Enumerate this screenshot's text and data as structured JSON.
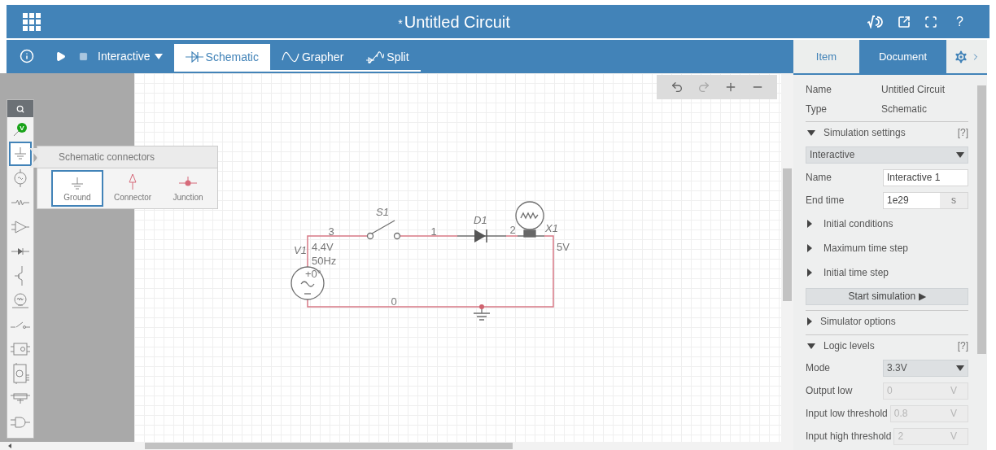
{
  "app_bar": {
    "modified_mark": "*",
    "title": "Untitled Circuit",
    "help": "?"
  },
  "toolbar": {
    "mode": "Interactive",
    "views": [
      {
        "label": "Schematic",
        "selected": true
      },
      {
        "label": "Grapher",
        "selected": false
      },
      {
        "label": "Split",
        "selected": false
      }
    ]
  },
  "palette": {
    "items": [
      {
        "kind": "probe",
        "label": "V",
        "selected": false
      },
      {
        "kind": "ground",
        "selected": true
      },
      {
        "kind": "source",
        "selected": false
      },
      {
        "kind": "resistor",
        "selected": false
      },
      {
        "kind": "amplifier",
        "selected": false
      },
      {
        "kind": "diode",
        "selected": false
      },
      {
        "kind": "transistor",
        "selected": false
      },
      {
        "kind": "lamp",
        "selected": false
      },
      {
        "kind": "switch",
        "selected": false
      },
      {
        "kind": "chip",
        "selected": false
      },
      {
        "kind": "timer",
        "selected": false
      },
      {
        "kind": "relay",
        "selected": false
      },
      {
        "kind": "gate",
        "selected": false
      }
    ],
    "flyout": {
      "title": "Schematic connectors",
      "items": [
        {
          "kind": "ground",
          "label": "Ground",
          "selected": true
        },
        {
          "kind": "connector",
          "label": "Connector",
          "selected": false
        },
        {
          "kind": "junction",
          "label": "Junction",
          "selected": false
        }
      ]
    }
  },
  "circuit": {
    "switch": "S1",
    "diode": "D1",
    "lamp": {
      "name": "X1",
      "rating": "5V"
    },
    "source": {
      "name": "V1",
      "amplitude": "4.4V",
      "frequency": "50Hz",
      "phase": "+0°"
    },
    "nodes": [
      "3",
      "1",
      "2",
      "0"
    ]
  },
  "panel_tabs": [
    {
      "label": "Item",
      "selected": false
    },
    {
      "label": "Document",
      "selected": true
    }
  ],
  "document": {
    "properties": [
      {
        "label": "Name",
        "value": "Untitled Circuit"
      },
      {
        "label": "Type",
        "value": "Schematic"
      }
    ],
    "sections": [
      {
        "title": "Simulation settings",
        "expanded": true,
        "help": "[?]",
        "items": [
          {
            "kind": "select",
            "value": "Interactive"
          },
          {
            "kind": "field",
            "label": "Name",
            "value": "Interactive 1",
            "disabled": false
          },
          {
            "kind": "field",
            "label": "End time",
            "value": "1e29",
            "unit": "s",
            "disabled": false
          },
          {
            "kind": "subsection",
            "label": "Initial conditions",
            "expanded": false
          },
          {
            "kind": "subsection",
            "label": "Maximum time step",
            "expanded": false
          },
          {
            "kind": "subsection",
            "label": "Initial time step",
            "expanded": false
          },
          {
            "kind": "button",
            "label": "Start simulation ▶"
          }
        ]
      },
      {
        "title": "Simulator options",
        "expanded": false
      },
      {
        "title": "Logic levels",
        "expanded": true,
        "help": "[?]",
        "items": [
          {
            "kind": "select",
            "label": "Mode",
            "value": "3.3V"
          },
          {
            "kind": "field",
            "label": "Output low",
            "value": "0",
            "unit": "V",
            "disabled": true
          },
          {
            "kind": "field",
            "label": "Input low threshold",
            "value": "0.8",
            "unit": "V",
            "disabled": true
          },
          {
            "kind": "field",
            "label": "Input high threshold",
            "value": "2",
            "unit": "V",
            "disabled": true
          }
        ]
      }
    ]
  }
}
